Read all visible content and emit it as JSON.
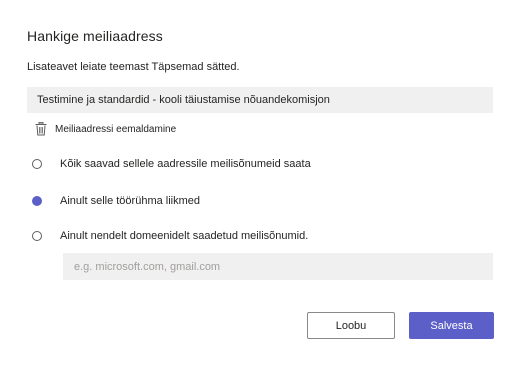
{
  "dialog": {
    "title": "Hankige meiliaadress",
    "subtitle": "Lisateavet leiate teemast Täpsemad sätted.",
    "address": "Testimine ja standardid - kooli täiustamise nõuandekomisjon",
    "remove_label": "Meiliaadressi eemaldamine",
    "options": [
      {
        "label": "Kõik saavad sellele aadressile meilisõnumeid saata",
        "checked": false
      },
      {
        "label": "Ainult selle töörühma liikmed",
        "checked": true
      },
      {
        "label": "Ainult nendelt domeenidelt saadetud meilisõnumid.",
        "checked": false
      }
    ],
    "domain_input": {
      "value": "",
      "placeholder": "e.g. microsoft.com, gmail.com"
    },
    "cancel_label": "Loobu",
    "save_label": "Salvesta"
  },
  "colors": {
    "accent": "#5b5fc7",
    "field_background": "#f0f0f0",
    "text": "#252423"
  },
  "icons": {
    "remove": "trash-icon"
  }
}
